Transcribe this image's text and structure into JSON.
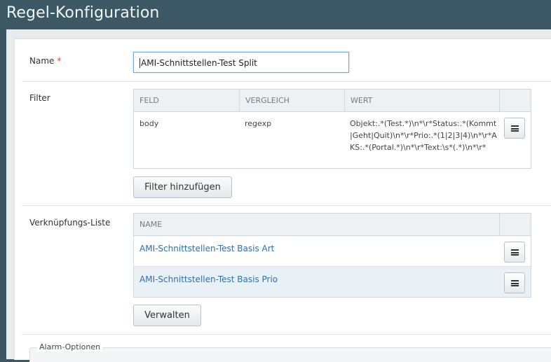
{
  "page": {
    "title": "Regel-Konfiguration"
  },
  "form": {
    "name_label": "Name",
    "required_mark": "*",
    "name_value": "AMI-Schnittstellen-Test Split",
    "filter_label": "Filter",
    "link_list_label": "Verknüpfungs-Liste",
    "alarm_options_label": "Alarm-Optionen"
  },
  "filter_table": {
    "headers": [
      "FELD",
      "VERGLEICH",
      "WERT"
    ],
    "rows": [
      {
        "feld": "body",
        "vergleich": "regexp",
        "wert": "Objekt:.*(Test.*)\\n*\\r*Status:.*(Kommt|Geht|Quit)\\n*\\r*Prio:.*(1|2|3|4)\\n*\\r*AKS:.*(Portal.*)\\n*\\r*Text:\\s*(.*)\\n*\\r*"
      }
    ],
    "add_button": "Filter hinzufügen"
  },
  "link_table": {
    "headers": [
      "NAME"
    ],
    "rows": [
      {
        "name": "AMI-Schnittstellen-Test Basis Art"
      },
      {
        "name": "AMI-Schnittstellen-Test Basis Prio"
      }
    ],
    "manage_button": "Verwalten"
  },
  "colors": {
    "header_bg": "#3d5865",
    "link": "#2f6fa8",
    "required": "#e04a2d",
    "selected_row": "#e9f1f7"
  }
}
